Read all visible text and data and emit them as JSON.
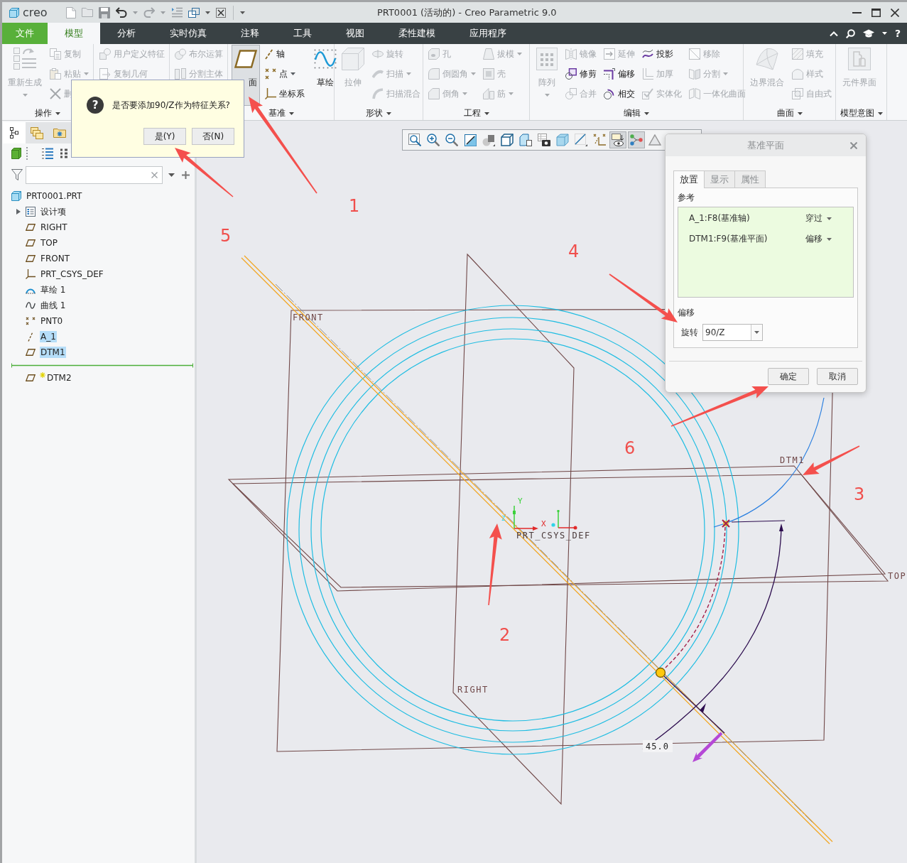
{
  "window": {
    "logo": "creo",
    "title": "PRT0001 (活动的) - Creo Parametric 9.0"
  },
  "ribbon": {
    "tabs": [
      {
        "label": "文件",
        "kind": "file",
        "selected": false
      },
      {
        "label": "模型",
        "kind": "tab",
        "selected": true
      },
      {
        "label": "分析",
        "kind": "tab",
        "selected": false
      },
      {
        "label": "实时仿真",
        "kind": "tab",
        "selected": false
      },
      {
        "label": "注释",
        "kind": "tab",
        "selected": false
      },
      {
        "label": "工具",
        "kind": "tab",
        "selected": false
      },
      {
        "label": "视图",
        "kind": "tab",
        "selected": false
      },
      {
        "label": "柔性建模",
        "kind": "tab",
        "selected": false
      },
      {
        "label": "应用程序",
        "kind": "tab",
        "selected": false
      }
    ],
    "help": "?",
    "groups": [
      {
        "label": "操作",
        "menu": true,
        "items": [
          {
            "label": "重新生成",
            "kind": "large",
            "menu": true,
            "disabled": true,
            "pressed": false
          },
          {
            "label": "复制",
            "kind": "small",
            "menu": false,
            "disabled": true,
            "pressed": false
          },
          {
            "label": "粘贴",
            "kind": "small",
            "menu": true,
            "disabled": true,
            "pressed": false
          },
          {
            "label": "删",
            "kind": "small",
            "menu": false,
            "disabled": true,
            "pressed": false
          }
        ]
      },
      {
        "items": [
          {
            "label": "用户定义特征",
            "kind": "small",
            "menu": false,
            "disabled": true,
            "pressed": false
          },
          {
            "label": "复制几何",
            "kind": "small",
            "menu": false,
            "disabled": true,
            "pressed": false
          }
        ]
      },
      {
        "items": [
          {
            "label": "布尔运算",
            "kind": "small",
            "menu": false,
            "disabled": true,
            "pressed": false
          },
          {
            "label": "分割主体",
            "kind": "small",
            "menu": false,
            "disabled": true,
            "pressed": false
          }
        ]
      },
      {
        "label": "基准",
        "menu": true,
        "items": [
          {
            "label": "面",
            "kind": "large",
            "menu": false,
            "disabled": false,
            "pressed": true
          },
          {
            "label": "轴",
            "kind": "small",
            "menu": false,
            "disabled": false,
            "pressed": false
          },
          {
            "label": "点",
            "kind": "small",
            "menu": true,
            "disabled": false,
            "pressed": false
          },
          {
            "label": "坐标系",
            "kind": "small",
            "menu": false,
            "disabled": false,
            "pressed": false
          },
          {
            "label": "草绘",
            "kind": "large",
            "menu": false,
            "disabled": false,
            "pressed": false
          }
        ]
      },
      {
        "label": "形状",
        "menu": true,
        "items": [
          {
            "label": "拉伸",
            "kind": "large",
            "menu": false,
            "disabled": true,
            "pressed": false
          },
          {
            "label": "旋转",
            "kind": "small",
            "menu": false,
            "disabled": true,
            "pressed": false
          },
          {
            "label": "扫描",
            "kind": "small",
            "menu": true,
            "disabled": true,
            "pressed": false
          },
          {
            "label": "扫描混合",
            "kind": "small",
            "menu": false,
            "disabled": true,
            "pressed": false
          }
        ]
      },
      {
        "label": "工程",
        "menu": true,
        "items": [
          {
            "label": "孔",
            "kind": "small",
            "menu": false,
            "disabled": true,
            "pressed": false
          },
          {
            "label": "倒圆角",
            "kind": "small",
            "menu": true,
            "disabled": true,
            "pressed": false
          },
          {
            "label": "倒角",
            "kind": "small",
            "menu": true,
            "disabled": true,
            "pressed": false
          },
          {
            "label": "拔模",
            "kind": "small",
            "menu": true,
            "disabled": true,
            "pressed": false
          },
          {
            "label": "壳",
            "kind": "small",
            "menu": false,
            "disabled": true,
            "pressed": false
          },
          {
            "label": "筋",
            "kind": "small",
            "menu": true,
            "disabled": true,
            "pressed": false
          }
        ]
      },
      {
        "label": "编辑",
        "menu": true,
        "items": [
          {
            "label": "阵列",
            "kind": "large",
            "menu": true,
            "disabled": true,
            "pressed": false
          },
          {
            "label": "镜像",
            "kind": "small",
            "menu": false,
            "disabled": true,
            "pressed": false
          },
          {
            "label": "修剪",
            "kind": "small",
            "menu": false,
            "disabled": false,
            "pressed": false
          },
          {
            "label": "合并",
            "kind": "small",
            "menu": false,
            "disabled": true,
            "pressed": false
          },
          {
            "label": "延伸",
            "kind": "small",
            "menu": false,
            "disabled": true,
            "pressed": false
          },
          {
            "label": "偏移",
            "kind": "small",
            "menu": false,
            "disabled": false,
            "pressed": false
          },
          {
            "label": "相交",
            "kind": "small",
            "menu": false,
            "disabled": false,
            "pressed": false
          },
          {
            "label": "投影",
            "kind": "small",
            "menu": false,
            "disabled": false,
            "pressed": false
          },
          {
            "label": "加厚",
            "kind": "small",
            "menu": false,
            "disabled": true,
            "pressed": false
          },
          {
            "label": "实体化",
            "kind": "small",
            "menu": false,
            "disabled": true,
            "pressed": false
          },
          {
            "label": "移除",
            "kind": "small",
            "menu": false,
            "disabled": true,
            "pressed": false
          },
          {
            "label": "分割",
            "kind": "small",
            "menu": true,
            "disabled": true,
            "pressed": false
          },
          {
            "label": "一体化曲面",
            "kind": "small",
            "menu": false,
            "disabled": true,
            "pressed": false
          }
        ]
      },
      {
        "label": "曲面",
        "menu": true,
        "items": [
          {
            "label": "边界混合",
            "kind": "large",
            "menu": false,
            "disabled": true,
            "pressed": false
          },
          {
            "label": "填充",
            "kind": "small",
            "menu": false,
            "disabled": true,
            "pressed": false
          },
          {
            "label": "样式",
            "kind": "small",
            "menu": false,
            "disabled": true,
            "pressed": false
          },
          {
            "label": "自由式",
            "kind": "small",
            "menu": false,
            "disabled": true,
            "pressed": false
          }
        ]
      },
      {
        "label": "模型意图",
        "menu": true,
        "items": [
          {
            "label": "元件界面",
            "kind": "large",
            "menu": false,
            "disabled": true,
            "pressed": false
          }
        ]
      }
    ]
  },
  "confirm_popup": {
    "icon": "?",
    "message": "是否要添加90/Z作为特征关系?",
    "buttons": [
      "是(Y)",
      "否(N)"
    ]
  },
  "model_tree": {
    "panel_tabs": [
      {
        "selected": true
      },
      {
        "selected": false
      },
      {
        "selected": false
      }
    ],
    "root": {
      "label": "PRT0001.PRT",
      "kind": "part",
      "children": [
        {
          "label": "设计项",
          "kind": "design-items",
          "expanded": false,
          "selected": false,
          "new": false
        },
        {
          "label": "RIGHT",
          "kind": "plane",
          "selected": false,
          "new": false
        },
        {
          "label": "TOP",
          "kind": "plane",
          "selected": false,
          "new": false
        },
        {
          "label": "FRONT",
          "kind": "plane",
          "selected": false,
          "new": false
        },
        {
          "label": "PRT_CSYS_DEF",
          "kind": "csys",
          "selected": false,
          "new": false
        },
        {
          "label": "草绘 1",
          "kind": "sketch",
          "selected": false,
          "new": false
        },
        {
          "label": "曲线 1",
          "kind": "curve",
          "selected": false,
          "new": false
        },
        {
          "label": "PNT0",
          "kind": "point",
          "selected": false,
          "new": false
        },
        {
          "label": "A_1",
          "kind": "axis",
          "selected": true,
          "new": false
        },
        {
          "label": "DTM1",
          "kind": "plane",
          "selected": true,
          "new": false
        },
        {
          "kind": "insert"
        },
        {
          "label": "DTM2",
          "kind": "plane",
          "selected": false,
          "new": true
        }
      ]
    }
  },
  "view_toolbar": [
    {
      "pressed": false
    },
    {
      "pressed": false
    },
    {
      "pressed": false
    },
    {
      "pressed": false
    },
    {
      "pressed": false
    },
    {
      "pressed": false
    },
    {
      "pressed": false
    },
    {
      "pressed": false
    },
    {
      "pressed": false
    },
    {
      "pressed": false
    },
    {
      "pressed": false
    },
    {
      "pressed": true
    },
    {
      "pressed": true
    },
    {
      "pressed": false
    }
  ],
  "graphics": {
    "planes": [
      {
        "label": "FRONT"
      },
      {
        "label": "RIGHT"
      },
      {
        "label": "TOP"
      },
      {
        "label": "DTM1"
      }
    ],
    "csys": {
      "label": "PRT_CSYS_DEF",
      "x": "X",
      "y": "Y",
      "z": "Z"
    },
    "dimension": "45.0"
  },
  "datum_dialog": {
    "title": "基准平面",
    "tabs": [
      {
        "label": "放置",
        "selected": true
      },
      {
        "label": "显示",
        "selected": false
      },
      {
        "label": "属性",
        "selected": false
      }
    ],
    "references_label": "参考",
    "references": [
      {
        "name": "A_1:F8(基准轴)",
        "constraint": "穿过"
      },
      {
        "name": "DTM1:F9(基准平面)",
        "constraint": "偏移"
      }
    ],
    "offset_label": "偏移",
    "rotation": {
      "label": "旋转",
      "value": "90/Z"
    },
    "buttons": [
      "确定",
      "取消"
    ]
  },
  "annotations": [
    "1",
    "2",
    "3",
    "4",
    "5",
    "6"
  ]
}
